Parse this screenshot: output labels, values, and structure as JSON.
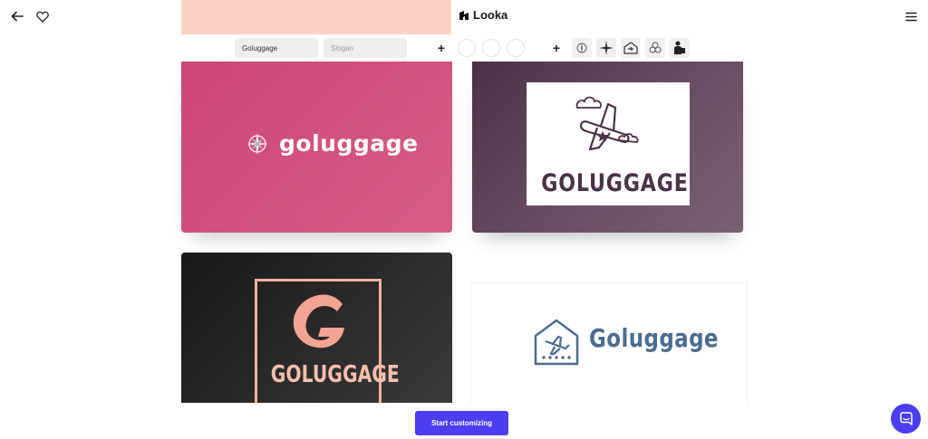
{
  "header": {
    "brand": "Looka",
    "back_icon": "arrow-left-icon",
    "favorite_icon": "heart-icon",
    "menu_icon": "hamburger-menu-icon"
  },
  "toolbar": {
    "name_value": "Goluggage",
    "slogan_placeholder": "Slogan",
    "add_label": "+",
    "symbols": [
      "compass-icon",
      "compass-rose-icon",
      "house-plane-icon",
      "flower-icon",
      "person-icon"
    ]
  },
  "cards": [
    {
      "name": "goluggage",
      "background": "#cc4577",
      "icon": "compass-icon"
    },
    {
      "name": "GOLUGGAGE",
      "background": "#5a3f54",
      "icon": "airplane-clouds-icon"
    },
    {
      "name": "GOLUGGAGE",
      "monogram": "G",
      "background": "#222222",
      "accent": "#f3a493"
    },
    {
      "name": "Goluggage",
      "background": "#ffffff",
      "accent": "#4a6c90",
      "icon": "house-plane-icon"
    }
  ],
  "cta": {
    "label": "Start customizing"
  },
  "chat": {
    "icon": "chat-icon"
  },
  "colors": {
    "accent": "#4b3ef1"
  }
}
